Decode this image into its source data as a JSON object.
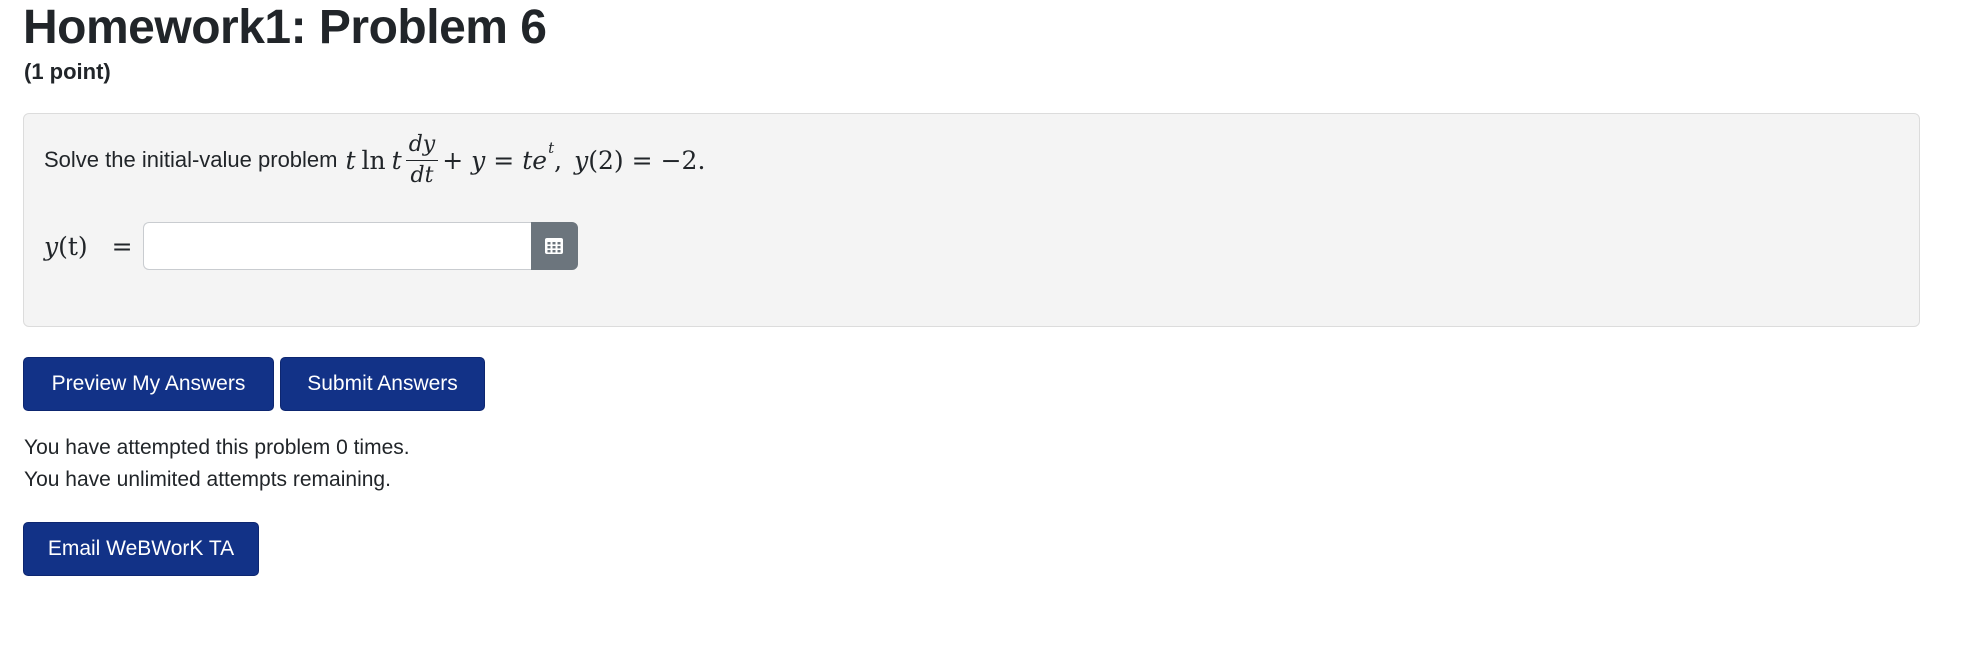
{
  "header": {
    "title": "Homework1: Problem 6",
    "points": "(1 point)"
  },
  "problem": {
    "intro": "Solve the initial-value problem",
    "equation": {
      "t1": "t",
      "ln": "ln",
      "t2": "t",
      "frac_num": "dy",
      "frac_den": "dt",
      "plus": "+",
      "y": "y",
      "eq": "=",
      "te": "te",
      "exp": "t",
      "comma": ",",
      "cond_y": "y",
      "cond_arg": "(2)",
      "cond_eq": "=",
      "cond_val": "−2",
      "period": "."
    },
    "answer_label": {
      "y": "y",
      "arg": "(t)",
      "eq": "="
    },
    "answer_value": "",
    "answer_placeholder": ""
  },
  "buttons": {
    "preview": "Preview My Answers",
    "submit": "Submit Answers",
    "email": "Email WeBWorK TA"
  },
  "status": {
    "attempted": "You have attempted this problem 0 times.",
    "remaining": "You have unlimited attempts remaining."
  },
  "icons": {
    "equation_button": "table-grid-icon"
  },
  "colors": {
    "button_bg": "#123287",
    "equation_button_bg": "#6c757d",
    "problem_bg": "#f4f4f4"
  }
}
